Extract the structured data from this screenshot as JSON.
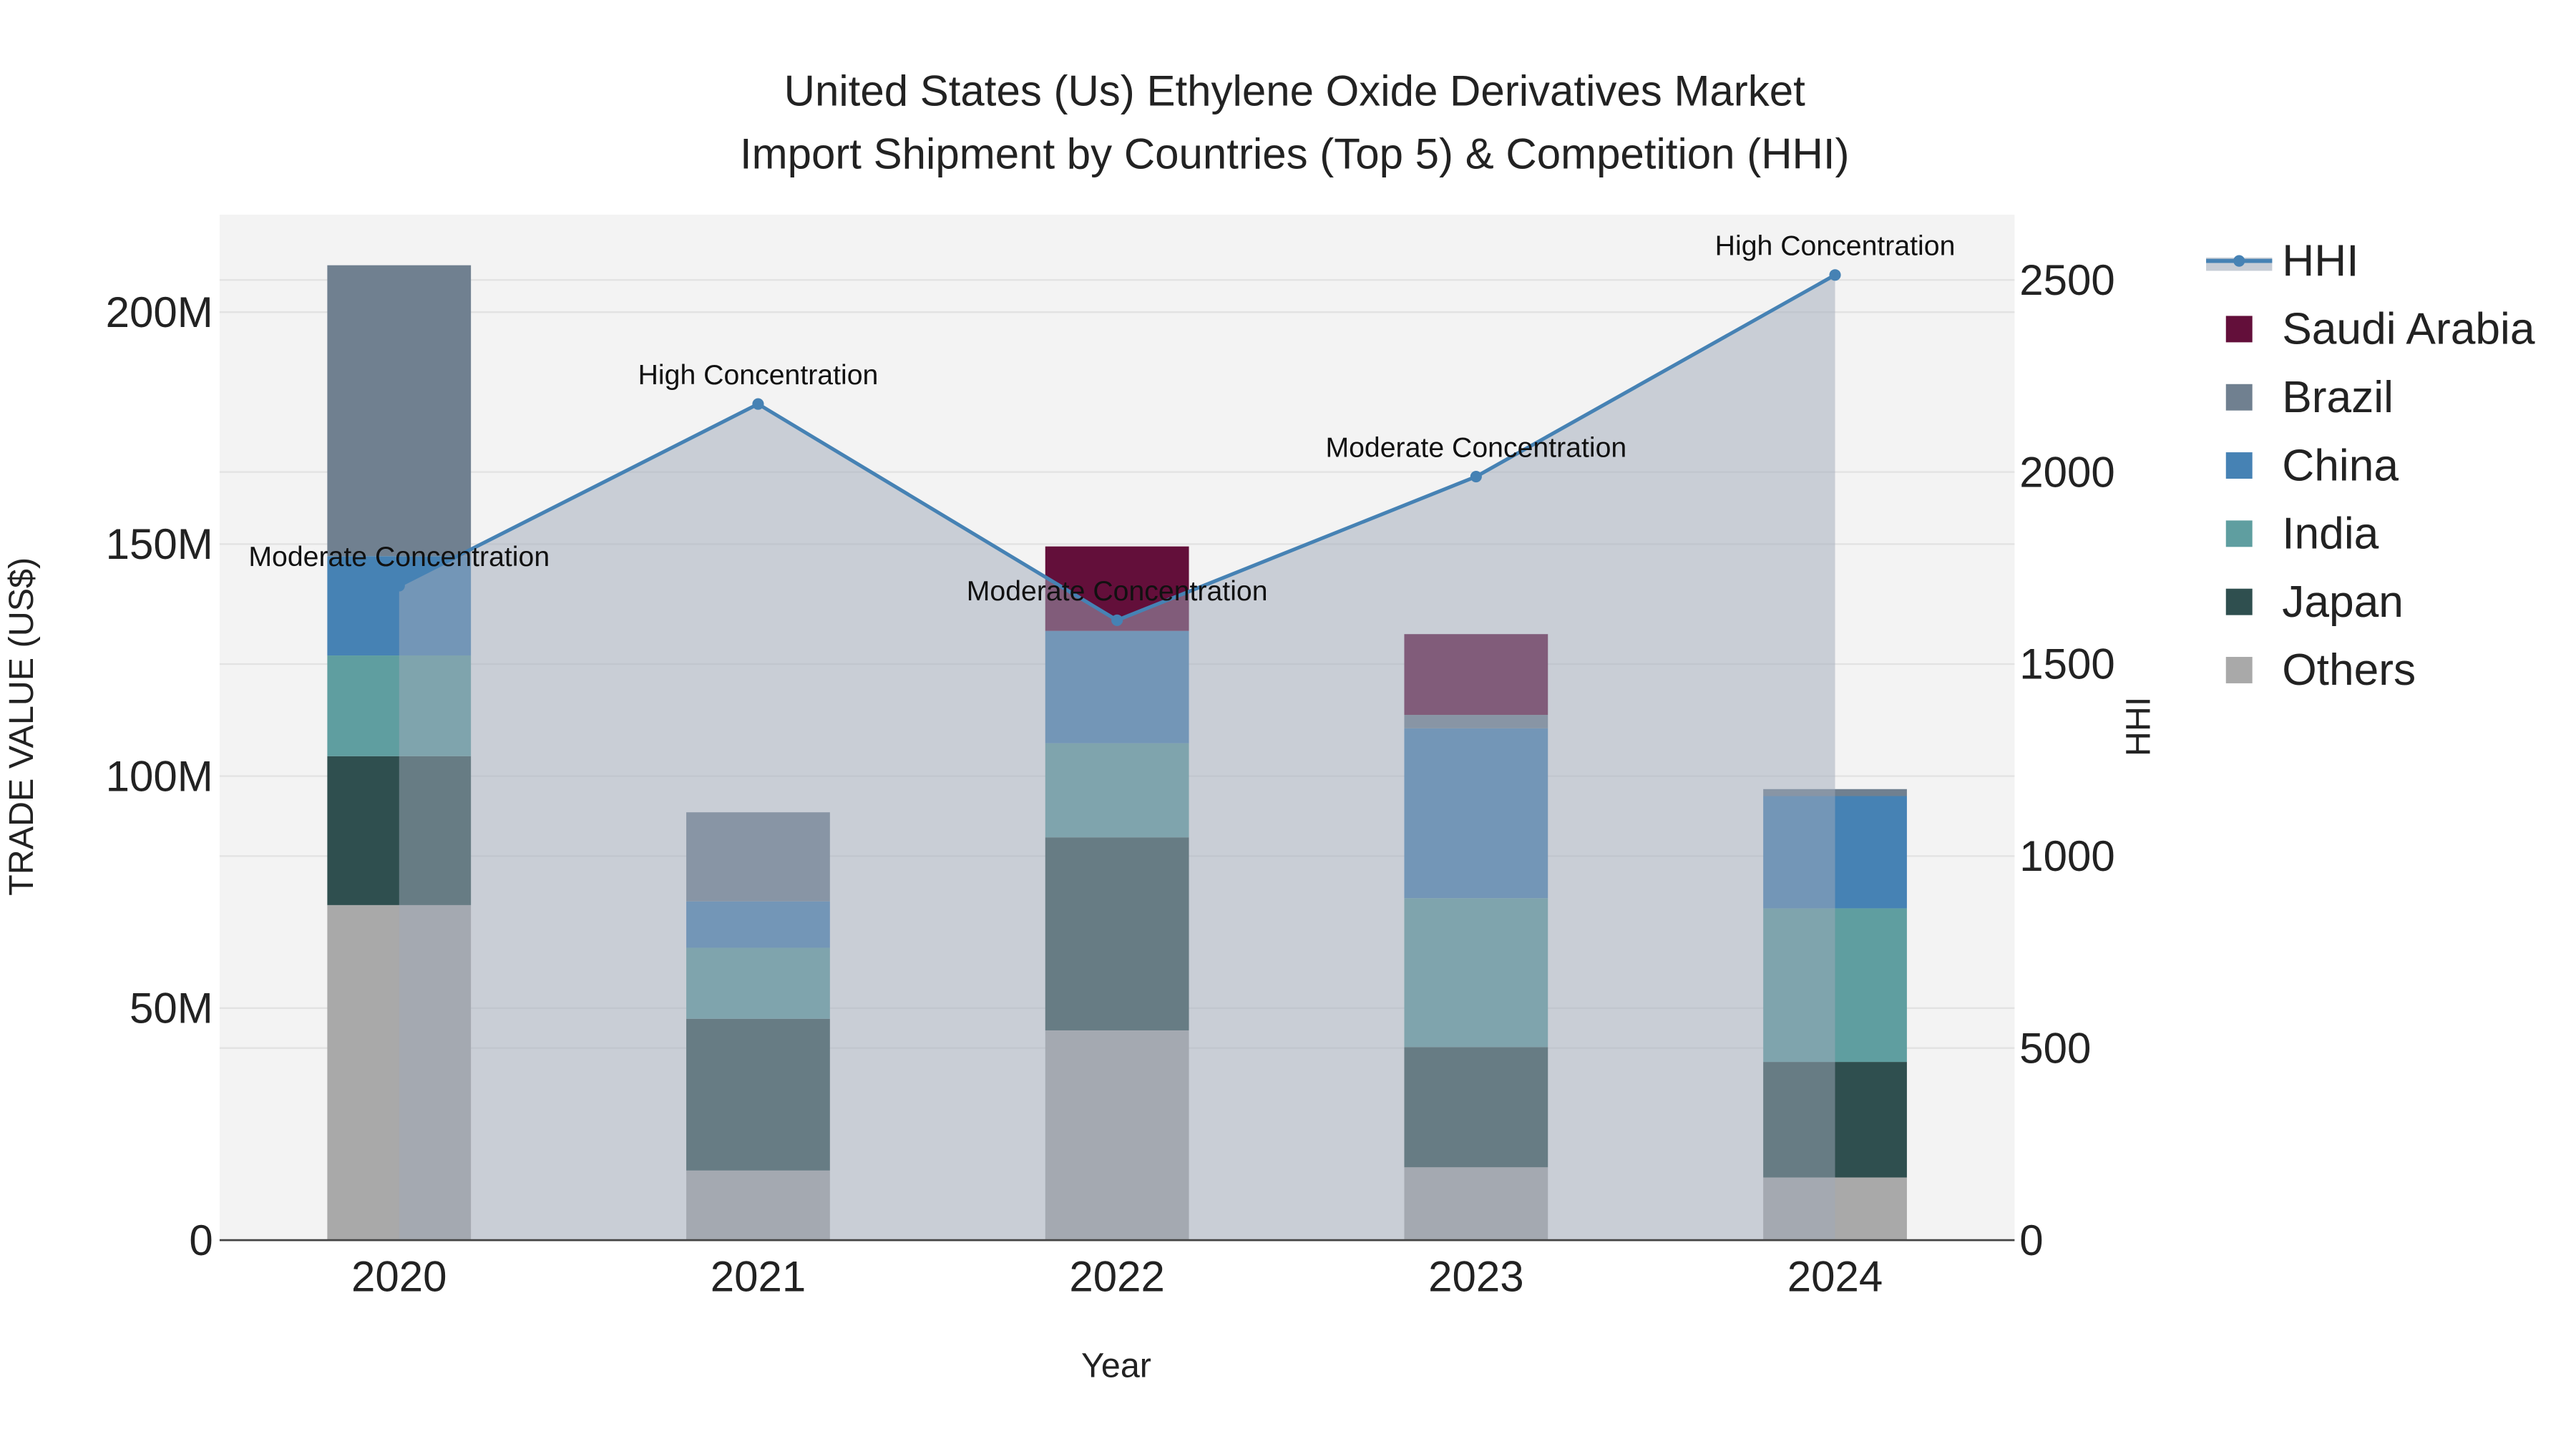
{
  "chart_data": {
    "type": "bar",
    "stacked": true,
    "title_line1": "United States (Us) Ethylene Oxide Derivatives Market",
    "title_line2": "Import Shipment by Countries (Top 5) & Competition (HHI)",
    "xlabel": "Year",
    "ylabel": "TRADE VALUE (US$)",
    "y2label": "HHI",
    "categories": [
      "2020",
      "2021",
      "2022",
      "2023",
      "2024"
    ],
    "ylim": [
      0,
      221
    ],
    "y2lim": [
      0,
      2670
    ],
    "yticks": [
      {
        "v": 0,
        "label": "0"
      },
      {
        "v": 50,
        "label": "50M"
      },
      {
        "v": 100,
        "label": "100M"
      },
      {
        "v": 150,
        "label": "150M"
      },
      {
        "v": 200,
        "label": "200M"
      }
    ],
    "y2ticks": [
      {
        "v": 0,
        "label": "0"
      },
      {
        "v": 500,
        "label": "500"
      },
      {
        "v": 1000,
        "label": "1000"
      },
      {
        "v": 1500,
        "label": "1500"
      },
      {
        "v": 2000,
        "label": "2000"
      },
      {
        "v": 2500,
        "label": "2500"
      }
    ],
    "value_unit": "M US$",
    "series": [
      {
        "name": "Others",
        "color": "#a9a9a9",
        "values": [
          72.2,
          15.0,
          45.2,
          15.7,
          13.5
        ]
      },
      {
        "name": "Japan",
        "color": "#2f4f4f",
        "values": [
          32.1,
          32.7,
          41.6,
          25.9,
          24.9
        ]
      },
      {
        "name": "India",
        "color": "#5f9ea0",
        "values": [
          21.7,
          15.3,
          20.3,
          32.1,
          33.1
        ]
      },
      {
        "name": "China",
        "color": "#4682b4",
        "values": [
          21.4,
          10.0,
          24.2,
          36.6,
          24.2
        ]
      },
      {
        "name": "Brazil",
        "color": "#708090",
        "values": [
          62.7,
          19.2,
          0,
          2.9,
          1.5
        ]
      },
      {
        "name": "Saudi Arabia",
        "color": "#630f3a",
        "values": [
          0,
          0,
          18.2,
          17.4,
          0
        ]
      }
    ],
    "hhi": {
      "name": "HHI",
      "color": "#4682b4",
      "values": [
        1704,
        2177,
        1614,
        1988,
        2513
      ],
      "annotations": [
        "Moderate Concentration",
        "High Concentration",
        "Moderate Concentration",
        "Moderate Concentration",
        "High Concentration"
      ]
    },
    "legend": [
      "HHI",
      "Saudi Arabia",
      "Brazil",
      "China",
      "India",
      "Japan",
      "Others"
    ],
    "legend_position": "right",
    "grid": true
  }
}
